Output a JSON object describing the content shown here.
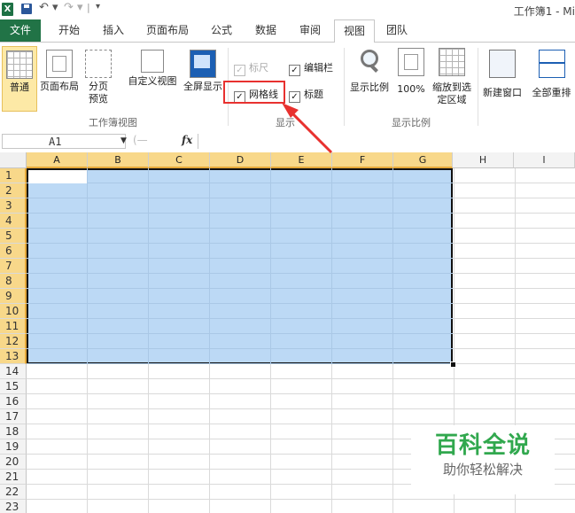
{
  "titlebar": {
    "logo_letter": "X",
    "title": "工作簿1 - Mi"
  },
  "tabs": [
    "文件",
    "开始",
    "插入",
    "页面布局",
    "公式",
    "数据",
    "审阅",
    "视图",
    "团队"
  ],
  "active_tab": "视图",
  "ribbon": {
    "workbook_views": {
      "label": "工作簿视图",
      "buttons": [
        "普通",
        "页面布局",
        "分页预览",
        "自定义视图",
        "全屏显示"
      ],
      "active": "普通"
    },
    "show": {
      "label": "显示",
      "checkboxes": [
        {
          "label": "标尺",
          "checked": true,
          "enabled": false
        },
        {
          "label": "编辑栏",
          "checked": true,
          "enabled": true
        },
        {
          "label": "网格线",
          "checked": true,
          "enabled": true
        },
        {
          "label": "标题",
          "checked": true,
          "enabled": true
        }
      ]
    },
    "zoom": {
      "label": "显示比例",
      "buttons": [
        "显示比例",
        "100%",
        "缩放到选定区域"
      ]
    },
    "window": {
      "buttons": [
        "新建窗口",
        "全部重排"
      ]
    }
  },
  "formula_bar": {
    "name_box": "A1",
    "fx": "fx",
    "value": ""
  },
  "sheet": {
    "columns": [
      "A",
      "B",
      "C",
      "D",
      "E",
      "F",
      "G",
      "H",
      "I"
    ],
    "selected_columns": [
      "A",
      "B",
      "C",
      "D",
      "E",
      "F",
      "G"
    ],
    "rows": [
      "1",
      "2",
      "3",
      "4",
      "5",
      "6",
      "7",
      "8",
      "9",
      "10",
      "11",
      "12",
      "13",
      "14",
      "15",
      "16",
      "17",
      "18",
      "19",
      "20",
      "21",
      "22",
      "23"
    ],
    "selected_rows_count": 13,
    "selection": "A1:G13",
    "selection_color": "#bcd9f5"
  },
  "watermark": {
    "title": "百科全说",
    "subtitle": "助你轻松解决"
  },
  "annotation": {
    "color": "#e8312f"
  }
}
